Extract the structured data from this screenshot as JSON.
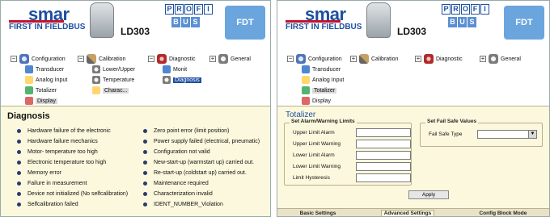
{
  "brand": {
    "smar": "smar",
    "tagline": "FIRST IN FIELDBUS",
    "model": "LD303",
    "profi_row1": [
      "P",
      "R",
      "O",
      "F",
      "I"
    ],
    "profi_row2": [
      "B",
      "U",
      "S"
    ],
    "fdt": "FDT"
  },
  "tree": {
    "configuration": "Configuration",
    "transducer": "Transducer",
    "analog_input": "Analog Input",
    "totalizer": "Totalizer",
    "display": "Display",
    "calibration": "Calibration",
    "lower_upper": "Lower/Upper",
    "temperature": "Temperature",
    "charac": "Charac...",
    "diagnostic": "Diagnostic",
    "monit": "Monit",
    "diagnosis": "Diagnosis",
    "general": "General"
  },
  "diagnosis": {
    "title": "Diagnosis",
    "col1": [
      "Hardware failure of the electronic",
      "Hardware failure  mechanics",
      "Motor- temperature too high",
      "Electronic temperature too high",
      "Memory error",
      "Failure in measurement",
      "Device not initialized (No selfcalibration)",
      "Selfcalibration failed"
    ],
    "col2": [
      "Zero point error (limit position)",
      "Power supply failed (electrical, pneumatic)",
      "Configuration not valid",
      "New-start-up (warmstart up) carried out.",
      "Re-start-up (coldstart up) carried out.",
      "Maintenance required",
      "Characterization invalid",
      "IDENT_NUMBER_Violation"
    ]
  },
  "totalizer": {
    "title": "Totalizer",
    "alarm_group": "Set Alarm/Warning Limits",
    "fields": [
      "Upper Limit Alarm",
      "Upper Limit Warning",
      "Lower Limit Alarm",
      "Lower Limit Warning",
      "Limit Hysteresis"
    ],
    "failsafe_group": "Set Fail Safe Values",
    "failsafe_label": "Fail Safe Type",
    "apply": "Apply",
    "tabs": [
      "Basic Settings",
      "Advanced  Settings",
      "Config Block Mode"
    ]
  },
  "colors": {
    "brand_blue": "#1d4f9f",
    "panel_bg": "#fcf8dd",
    "selection": "#1f4fa1"
  }
}
